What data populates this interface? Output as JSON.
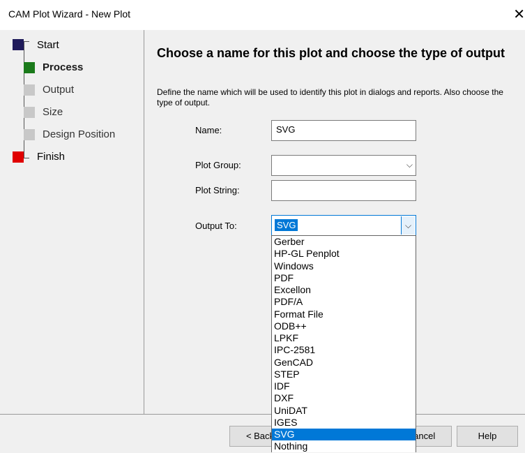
{
  "window": {
    "title": "CAM Plot  Wizard - New Plot",
    "close": "✕"
  },
  "nav": {
    "items": [
      {
        "label": "Start",
        "color": "#1f1a5a",
        "state": "done"
      },
      {
        "label": "Process",
        "color": "#1a7a1a",
        "state": "active"
      },
      {
        "label": "Output",
        "color": "#c8c8c8",
        "state": "pending"
      },
      {
        "label": "Size",
        "color": "#c8c8c8",
        "state": "pending"
      },
      {
        "label": "Design Position",
        "color": "#c8c8c8",
        "state": "pending"
      },
      {
        "label": "Finish",
        "color": "#e00000",
        "state": "end"
      }
    ]
  },
  "page": {
    "heading": "Choose a name for this plot and choose the type of output",
    "description": "Define the name which will be used to identify this plot in dialogs and reports. Also choose the type of output."
  },
  "form": {
    "name_label": "Name:",
    "name_value": "SVG",
    "plot_group_label": "Plot Group:",
    "plot_group_value": "",
    "plot_string_label": "Plot String:",
    "plot_string_value": "",
    "output_to_label": "Output To:",
    "output_to_value": "SVG",
    "dropdown_arrow": "⌵"
  },
  "output_options": [
    "Gerber",
    "HP-GL Penplot",
    "Windows",
    "PDF",
    "Excellon",
    "PDF/A",
    "Format File",
    "ODB++",
    "LPKF",
    "IPC-2581",
    "GenCAD",
    "STEP",
    "IDF",
    "DXF",
    "UniDAT",
    "IGES",
    "SVG",
    "Nothing"
  ],
  "selected_option": "SVG",
  "buttons": {
    "back": "< Back",
    "cancel": "Cancel",
    "help": "Help"
  },
  "colors": {
    "accent": "#0078d7",
    "panel": "#f0f0f0"
  }
}
